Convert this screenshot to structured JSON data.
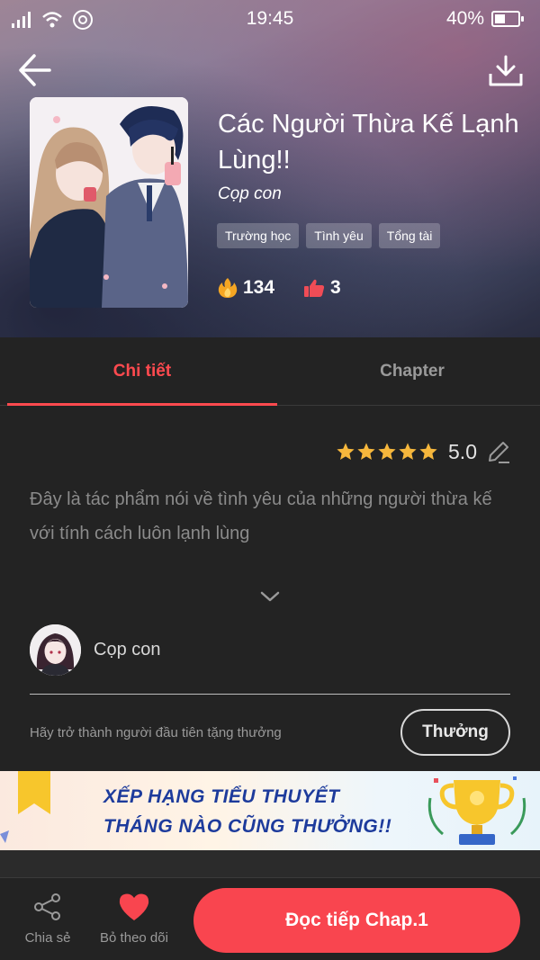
{
  "status_bar": {
    "time": "19:45",
    "battery": "40%",
    "battery_level": 0.4
  },
  "book": {
    "title": "Các Người Thừa Kế Lạnh Lùng!!",
    "author": "Cọp con",
    "tags": [
      "Trường học",
      "Tình yêu",
      "Tổng tài"
    ],
    "views": "134",
    "likes": "3"
  },
  "tabs": [
    {
      "label": "Chi tiết",
      "active": true
    },
    {
      "label": "Chapter",
      "active": false
    }
  ],
  "rating": {
    "value": "5.0",
    "stars": 5
  },
  "description": "Đây là tác phẩm nói về tình yêu của những người thừa kế với tính cách luôn lạnh lùng",
  "author_section": {
    "name": "Cọp con"
  },
  "reward": {
    "prompt": "Hãy trở thành người đầu tiên tặng thưởng",
    "button_label": "Thưởng"
  },
  "banner": {
    "line1": "XẾP HẠNG TIỂU THUYẾT",
    "line2": "THÁNG NÀO CŨNG THƯỞNG!!"
  },
  "bottom_bar": {
    "share_label": "Chia sẻ",
    "unfollow_label": "Bỏ theo dõi",
    "read_button": "Đọc tiếp Chap.1"
  },
  "colors": {
    "accent": "#f9454f",
    "background": "#232323",
    "star": "#f6b73c",
    "banner_text": "#1d3b9c"
  }
}
